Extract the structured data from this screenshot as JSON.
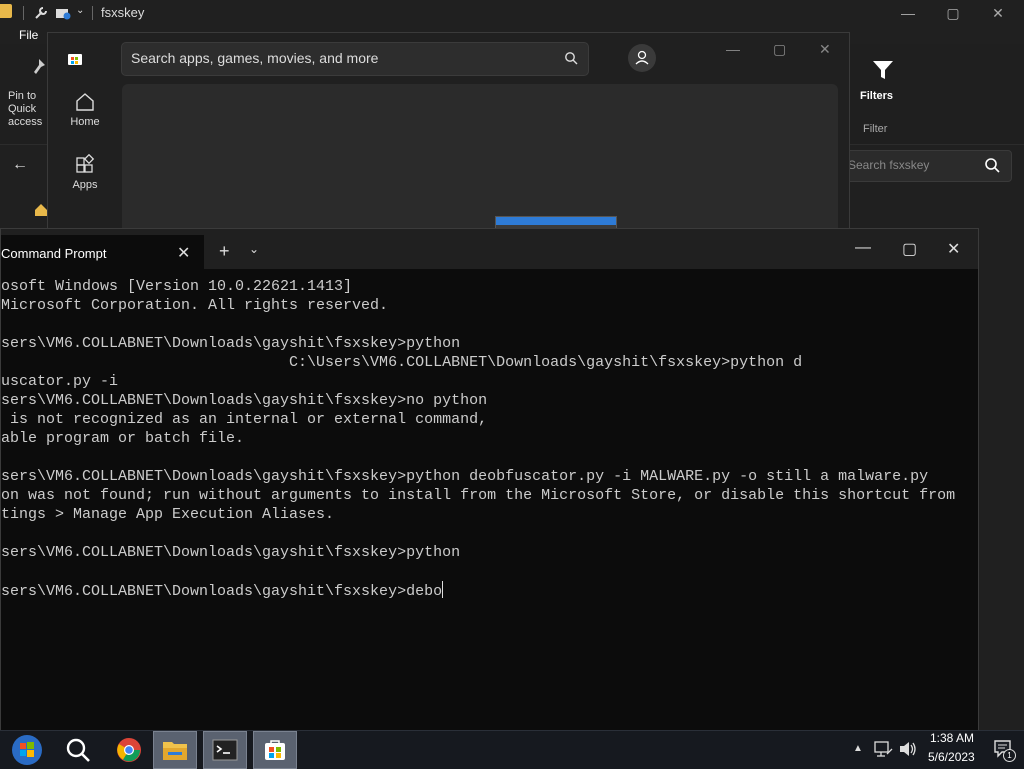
{
  "explorer": {
    "title": "fsxskey",
    "menu_file": "File",
    "pin_label": "Pin to Quick access",
    "filters_label": "Filters",
    "filter_group_label": "Filter",
    "search_placeholder": "Search fsxskey"
  },
  "store": {
    "search_placeholder": "Search apps, games, movies, and more",
    "nav": [
      {
        "label": "Home",
        "icon": "home-icon"
      },
      {
        "label": "Apps",
        "icon": "apps-icon"
      }
    ]
  },
  "cmd": {
    "tab_title": "Command Prompt",
    "lines": [
      "osoft Windows [Version 10.0.22621.1413]",
      "Microsoft Corporation. All rights reserved.",
      "",
      "sers\\VM6.COLLABNET\\Downloads\\gayshit\\fsxskey>python",
      "                                C:\\Users\\VM6.COLLABNET\\Downloads\\gayshit\\fsxskey>python d",
      "uscator.py -i",
      "sers\\VM6.COLLABNET\\Downloads\\gayshit\\fsxskey>no python",
      " is not recognized as an internal or external command,",
      "able program or batch file.",
      "",
      "sers\\VM6.COLLABNET\\Downloads\\gayshit\\fsxskey>python deobfuscator.py -i MALWARE.py -o still a malware.py",
      "on was not found; run without arguments to install from the Microsoft Store, or disable this shortcut from",
      "tings > Manage App Execution Aliases.",
      "",
      "sers\\VM6.COLLABNET\\Downloads\\gayshit\\fsxskey>python",
      "",
      "sers\\VM6.COLLABNET\\Downloads\\gayshit\\fsxskey>debo"
    ]
  },
  "taskbar": {
    "time": "1:38 AM",
    "date": "5/6/2023",
    "notification_count": "1",
    "apps": [
      "start-orb",
      "search",
      "chrome",
      "file-explorer",
      "terminal",
      "microsoft-store"
    ]
  }
}
